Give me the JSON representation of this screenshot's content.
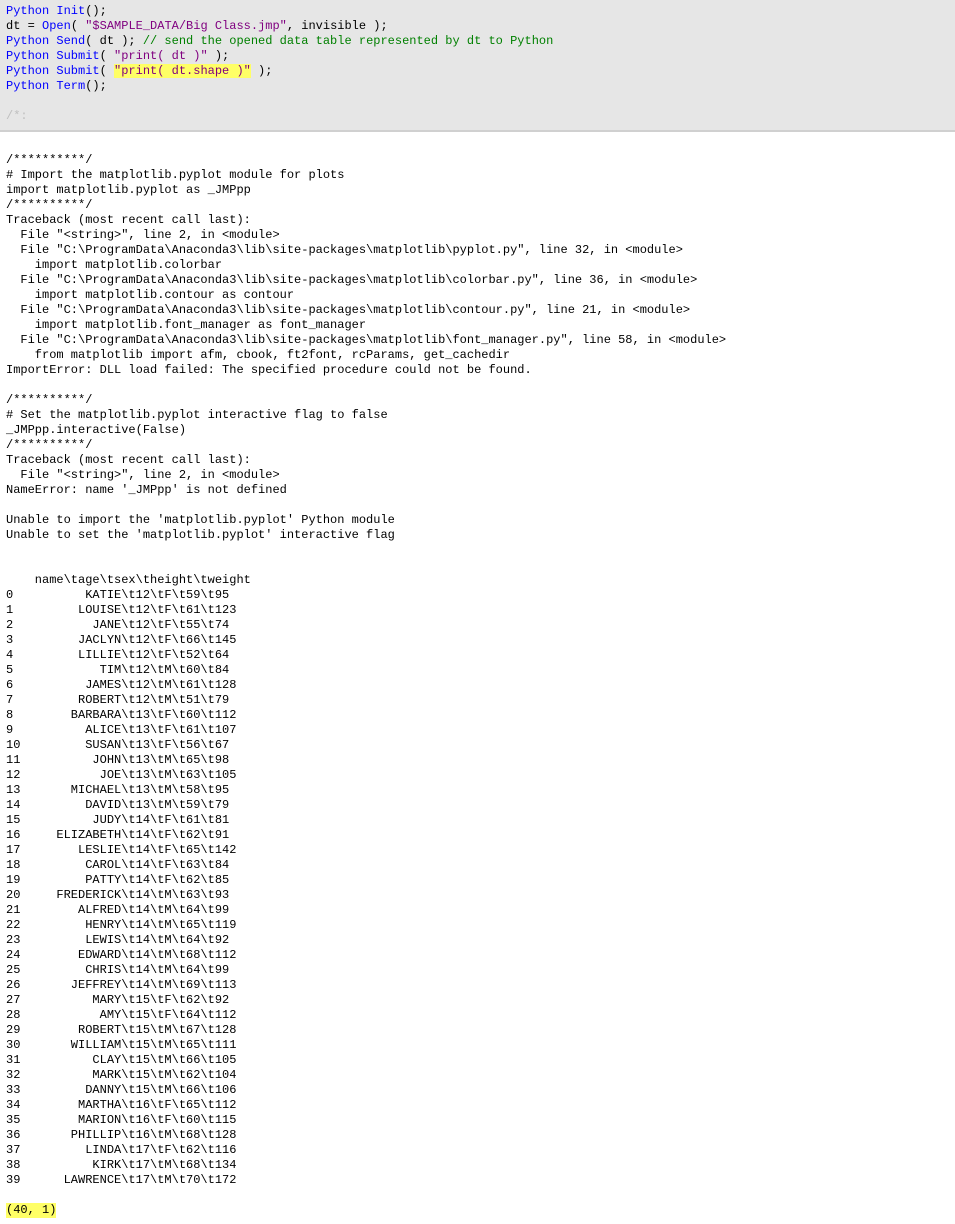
{
  "code": {
    "l1a": "Python Init",
    "l1b": "();",
    "l2a": "dt = ",
    "l2b": "Open",
    "l2c": "( ",
    "l2d": "\"$SAMPLE_DATA/Big Class.jmp\"",
    "l2e": ", invisible );",
    "l3a": "Python Send",
    "l3b": "( dt ); ",
    "l3c": "// send the opened data table represented by dt to Python",
    "l4a": "Python Submit",
    "l4b": "( ",
    "l4c": "\"print( dt )\"",
    "l4d": " );",
    "l5a": "Python Submit",
    "l5b": "( ",
    "l5c": "\"print( dt.shape )\"",
    "l5d": " );",
    "l6a": "Python Term",
    "l6b": "();",
    "l7": "/*:"
  },
  "out": {
    "sep1": "/**********/",
    "imp1": "# Import the matplotlib.pyplot module for plots",
    "imp2": "import matplotlib.pyplot as _JMPpp",
    "sep2": "/**********/",
    "tb1": "Traceback (most recent call last):",
    "tb2": "  File \"<string>\", line 2, in <module>",
    "tb3": "  File \"C:\\ProgramData\\Anaconda3\\lib\\site-packages\\matplotlib\\pyplot.py\", line 32, in <module>",
    "tb4": "    import matplotlib.colorbar",
    "tb5": "  File \"C:\\ProgramData\\Anaconda3\\lib\\site-packages\\matplotlib\\colorbar.py\", line 36, in <module>",
    "tb6": "    import matplotlib.contour as contour",
    "tb7": "  File \"C:\\ProgramData\\Anaconda3\\lib\\site-packages\\matplotlib\\contour.py\", line 21, in <module>",
    "tb8": "    import matplotlib.font_manager as font_manager",
    "tb9": "  File \"C:\\ProgramData\\Anaconda3\\lib\\site-packages\\matplotlib\\font_manager.py\", line 58, in <module>",
    "tb10": "    from matplotlib import afm, cbook, ft2font, rcParams, get_cachedir",
    "tb11": "ImportError: DLL load failed: The specified procedure could not be found.",
    "sep3": "/**********/",
    "set1": "# Set the matplotlib.pyplot interactive flag to false",
    "set2": "_JMPpp.interactive(False)",
    "sep4": "/**********/",
    "tb2_1": "Traceback (most recent call last):",
    "tb2_2": "  File \"<string>\", line 2, in <module>",
    "tb2_3": "NameError: name '_JMPpp' is not defined",
    "err1": "Unable to import the 'matplotlib.pyplot' Python module",
    "err2": "Unable to set the 'matplotlib.pyplot' interactive flag",
    "header": "    name\\tage\\tsex\\theight\\tweight",
    "rows": [
      "0          KATIE\\t12\\tF\\t59\\t95",
      "1         LOUISE\\t12\\tF\\t61\\t123",
      "2           JANE\\t12\\tF\\t55\\t74",
      "3         JACLYN\\t12\\tF\\t66\\t145",
      "4         LILLIE\\t12\\tF\\t52\\t64",
      "5            TIM\\t12\\tM\\t60\\t84",
      "6          JAMES\\t12\\tM\\t61\\t128",
      "7         ROBERT\\t12\\tM\\t51\\t79",
      "8        BARBARA\\t13\\tF\\t60\\t112",
      "9          ALICE\\t13\\tF\\t61\\t107",
      "10         SUSAN\\t13\\tF\\t56\\t67",
      "11          JOHN\\t13\\tM\\t65\\t98",
      "12           JOE\\t13\\tM\\t63\\t105",
      "13       MICHAEL\\t13\\tM\\t58\\t95",
      "14         DAVID\\t13\\tM\\t59\\t79",
      "15          JUDY\\t14\\tF\\t61\\t81",
      "16     ELIZABETH\\t14\\tF\\t62\\t91",
      "17        LESLIE\\t14\\tF\\t65\\t142",
      "18         CAROL\\t14\\tF\\t63\\t84",
      "19         PATTY\\t14\\tF\\t62\\t85",
      "20     FREDERICK\\t14\\tM\\t63\\t93",
      "21        ALFRED\\t14\\tM\\t64\\t99",
      "22         HENRY\\t14\\tM\\t65\\t119",
      "23         LEWIS\\t14\\tM\\t64\\t92",
      "24        EDWARD\\t14\\tM\\t68\\t112",
      "25         CHRIS\\t14\\tM\\t64\\t99",
      "26       JEFFREY\\t14\\tM\\t69\\t113",
      "27          MARY\\t15\\tF\\t62\\t92",
      "28           AMY\\t15\\tF\\t64\\t112",
      "29        ROBERT\\t15\\tM\\t67\\t128",
      "30       WILLIAM\\t15\\tM\\t65\\t111",
      "31          CLAY\\t15\\tM\\t66\\t105",
      "32          MARK\\t15\\tM\\t62\\t104",
      "33         DANNY\\t15\\tM\\t66\\t106",
      "34        MARTHA\\t16\\tF\\t65\\t112",
      "35        MARION\\t16\\tF\\t60\\t115",
      "36       PHILLIP\\t16\\tM\\t68\\t128",
      "37         LINDA\\t17\\tF\\t62\\t116",
      "38          KIRK\\t17\\tM\\t68\\t134",
      "39      LAWRENCE\\t17\\tM\\t70\\t172"
    ],
    "shape": "(40, 1)"
  }
}
